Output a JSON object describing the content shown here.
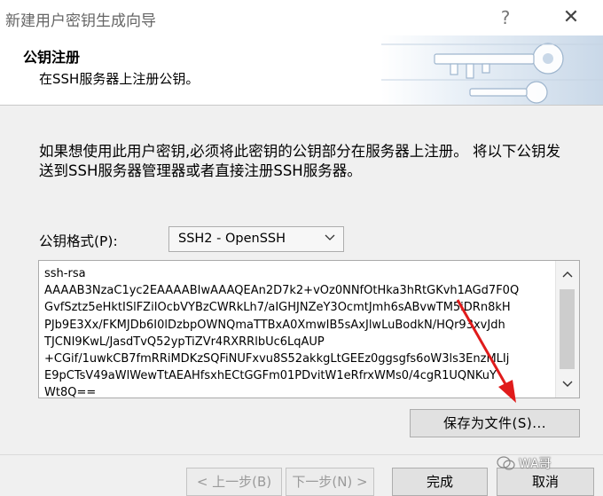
{
  "window": {
    "title": "新建用户密钥生成向导",
    "help_icon": "?",
    "close_icon": "✕"
  },
  "header": {
    "title": "公钥注册",
    "subtitle": "在SSH服务器上注册公钥。"
  },
  "description": "如果想使用此用户密钥,必须将此密钥的公钥部分在服务器上注册。 将以下公钥发送到SSH服务器管理器或者直接注册SSH服务器。",
  "format": {
    "label": "公钥格式(P):",
    "selected": "SSH2 - OpenSSH"
  },
  "key_text": "ssh-rsa\nAAAAB3NzaC1yc2EAAAABIwAAAQEAn2D7k2+vOz0NNfOtHka3hRtGKvh1AGd7F0Q\nGvfSztz5eHktISlFZiIOcbVYBzCWRkLh7/aIGHJNZeY3OcmtJmh6sABvwTM5iDRn8kH\nPJb9E3Xx/FKMJDb6I0lDzbpOWNQmaTTBxA0XmwIB5sAxJlwLuBodkN/HQr93xvJdh\nTJCNI9KwL/JasdTvQ52ypTiZVr4RXRRlbUc6LqAUP\n+CGif/1uwkCB7fmRRiMDKzSQFiNUFxvu8S52akkgLtGEEz0ggsgfs6oW3ls3EnzMLIj\nE9pCTsV49aWlWewTtAEAHfsxhECtGGFm01PDvitW1eRfrxWMs0/4cgR1UQNKuY\nWt8Q==",
  "save_button": "保存为文件(S)...",
  "buttons": {
    "prev": "< 上一步(B)",
    "next": "下一步(N) >",
    "finish": "完成",
    "cancel": "取消"
  },
  "watermark": "WA哥"
}
